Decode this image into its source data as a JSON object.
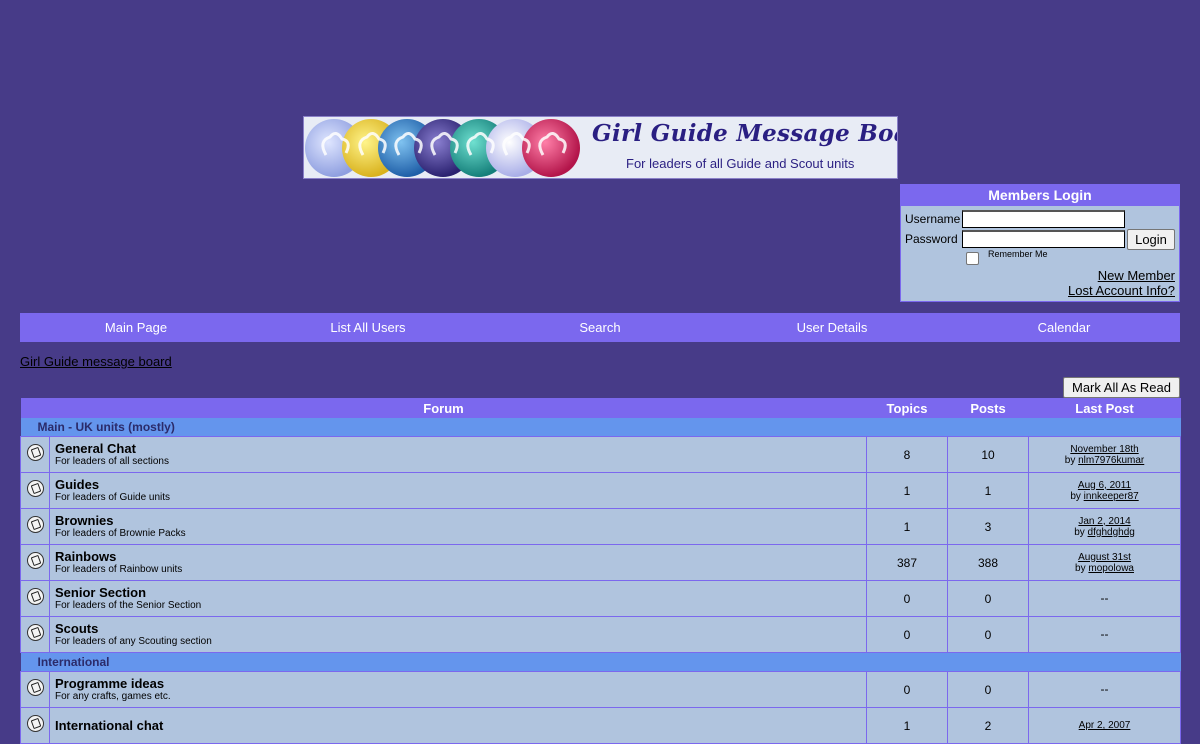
{
  "banner": {
    "title": "Girl Guide Message Board",
    "subtitle": "For leaders of all Guide and Scout units"
  },
  "login": {
    "header": "Members Login",
    "username_label": "Username",
    "password_label": "Password",
    "username_value": "",
    "password_value": "",
    "login_button": "Login",
    "remember_me": "Remember Me",
    "new_member": "New Member",
    "lost_account": "Lost Account Info?"
  },
  "nav": {
    "items": [
      "Main Page",
      "List All Users",
      "Search",
      "User Details",
      "Calendar"
    ]
  },
  "breadcrumb": "Girl Guide message board",
  "mark_all_read": "Mark All As Read",
  "table": {
    "headers": [
      "Forum",
      "Topics",
      "Posts",
      "Last Post"
    ],
    "categories": [
      {
        "name": "Main - UK units (mostly)",
        "forums": [
          {
            "name": "General Chat",
            "desc": "For leaders of all sections",
            "topics": "8",
            "posts": "10",
            "last_date": "November 18th",
            "last_by": "by ",
            "last_user": "nlm7976kumar"
          },
          {
            "name": "Guides",
            "desc": "For leaders of Guide units",
            "topics": "1",
            "posts": "1",
            "last_date": "Aug 6, 2011",
            "last_by": "by ",
            "last_user": "innkeeper87"
          },
          {
            "name": "Brownies",
            "desc": "For leaders of Brownie Packs",
            "topics": "1",
            "posts": "3",
            "last_date": "Jan 2, 2014",
            "last_by": "by ",
            "last_user": "dfghdghdg"
          },
          {
            "name": "Rainbows",
            "desc": "For leaders of Rainbow units",
            "topics": "387",
            "posts": "388",
            "last_date": "August 31st",
            "last_by": "by ",
            "last_user": "mopolowa"
          },
          {
            "name": "Senior Section",
            "desc": "For leaders of the Senior Section",
            "topics": "0",
            "posts": "0",
            "last_date": "--",
            "last_by": "",
            "last_user": ""
          },
          {
            "name": "Scouts",
            "desc": "For leaders of any Scouting section",
            "topics": "0",
            "posts": "0",
            "last_date": "--",
            "last_by": "",
            "last_user": ""
          }
        ]
      },
      {
        "name": "International",
        "forums": [
          {
            "name": "Programme ideas",
            "desc": "For any crafts, games etc.",
            "topics": "0",
            "posts": "0",
            "last_date": "--",
            "last_by": "",
            "last_user": ""
          },
          {
            "name": "International chat",
            "desc": "",
            "topics": "1",
            "posts": "2",
            "last_date": "Apr 2, 2007",
            "last_by": "",
            "last_user": ""
          }
        ]
      }
    ]
  },
  "colors": {
    "background": "#473b88",
    "accent": "#7b68ee",
    "panel": "#b0c4de",
    "category": "#6495ed"
  }
}
